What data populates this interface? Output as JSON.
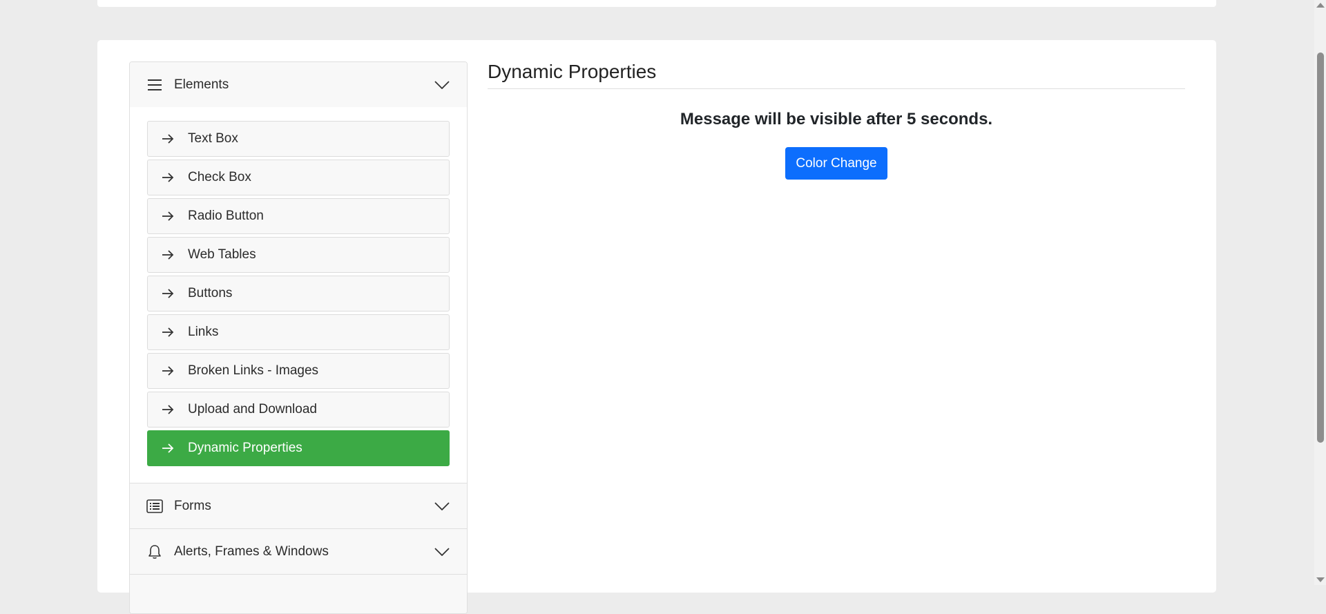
{
  "sidebar": {
    "elements_group": {
      "label": "Elements",
      "icon": "hamburger-icon",
      "expanded": true,
      "items": [
        {
          "label": "Text Box",
          "active": false
        },
        {
          "label": "Check Box",
          "active": false
        },
        {
          "label": "Radio Button",
          "active": false
        },
        {
          "label": "Web Tables",
          "active": false
        },
        {
          "label": "Buttons",
          "active": false
        },
        {
          "label": "Links",
          "active": false
        },
        {
          "label": "Broken Links - Images",
          "active": false
        },
        {
          "label": "Upload and Download",
          "active": false
        },
        {
          "label": "Dynamic Properties",
          "active": true
        }
      ]
    },
    "forms_group": {
      "label": "Forms",
      "icon": "list-icon"
    },
    "alerts_group": {
      "label": "Alerts, Frames & Windows",
      "icon": "bell-icon"
    }
  },
  "main": {
    "title": "Dynamic Properties",
    "message": "Message will be visible after 5 seconds.",
    "color_change_button": "Color Change"
  },
  "colors": {
    "active_item": "#3caa45",
    "primary_button": "#0d6efd",
    "page_background": "#ececec"
  }
}
